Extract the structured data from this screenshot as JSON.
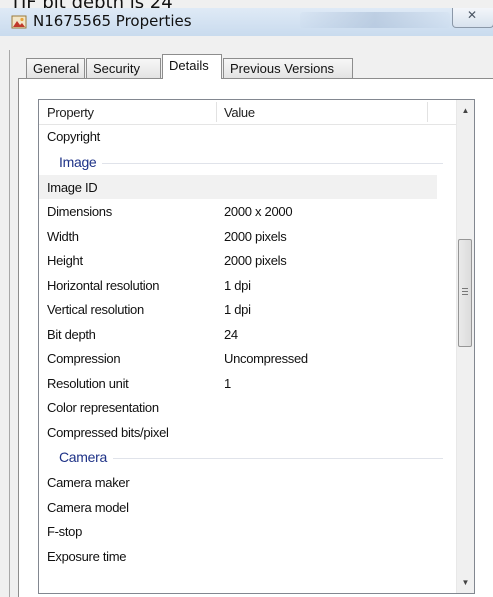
{
  "caption": "TIF bit depth is 24",
  "window": {
    "title": "N1675565 Properties",
    "close_label": "✕"
  },
  "tabs": [
    {
      "label": "General",
      "active": false
    },
    {
      "label": "Security",
      "active": false
    },
    {
      "label": "Details",
      "active": true
    },
    {
      "label": "Previous Versions",
      "active": false
    }
  ],
  "list": {
    "headers": {
      "property": "Property",
      "value": "Value"
    },
    "rows": [
      {
        "kind": "item",
        "property": "Copyright",
        "value": ""
      },
      {
        "kind": "group",
        "label": "Image"
      },
      {
        "kind": "item",
        "property": "Image ID",
        "value": "",
        "selected": true
      },
      {
        "kind": "item",
        "property": "Dimensions",
        "value": "2000 x 2000"
      },
      {
        "kind": "item",
        "property": "Width",
        "value": "2000 pixels"
      },
      {
        "kind": "item",
        "property": "Height",
        "value": "2000 pixels"
      },
      {
        "kind": "item",
        "property": "Horizontal resolution",
        "value": "1 dpi"
      },
      {
        "kind": "item",
        "property": "Vertical resolution",
        "value": "1 dpi"
      },
      {
        "kind": "item",
        "property": "Bit depth",
        "value": "24"
      },
      {
        "kind": "item",
        "property": "Compression",
        "value": "Uncompressed"
      },
      {
        "kind": "item",
        "property": "Resolution unit",
        "value": "1"
      },
      {
        "kind": "item",
        "property": "Color representation",
        "value": ""
      },
      {
        "kind": "item",
        "property": "Compressed bits/pixel",
        "value": ""
      },
      {
        "kind": "group",
        "label": "Camera"
      },
      {
        "kind": "item",
        "property": "Camera maker",
        "value": ""
      },
      {
        "kind": "item",
        "property": "Camera model",
        "value": ""
      },
      {
        "kind": "item",
        "property": "F-stop",
        "value": ""
      },
      {
        "kind": "item",
        "property": "Exposure time",
        "value": ""
      }
    ]
  },
  "colors": {
    "group_label": "#1e3287",
    "selected_row": "#f1f1f1",
    "titlebar": "#c9dbee"
  }
}
